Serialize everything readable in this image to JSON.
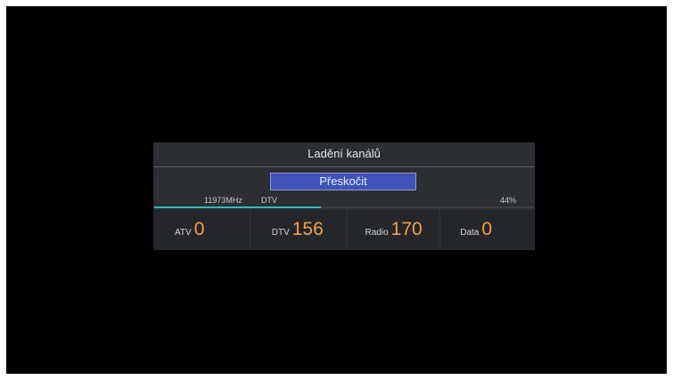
{
  "dialog": {
    "title": "Ladění kanálů",
    "skip_label": "Přeskočit",
    "frequency": "11973MHz",
    "signal_type": "DTV",
    "progress_text": "44%",
    "progress_fraction": 0.44
  },
  "counts": [
    {
      "label": "ATV",
      "value": "0"
    },
    {
      "label": "DTV",
      "value": "156"
    },
    {
      "label": "Radio",
      "value": "170"
    },
    {
      "label": "Data",
      "value": "0"
    }
  ],
  "colors": {
    "accent_button": "#3f52b8",
    "progress": "#36b7c2",
    "count_value": "#f0a24a"
  }
}
